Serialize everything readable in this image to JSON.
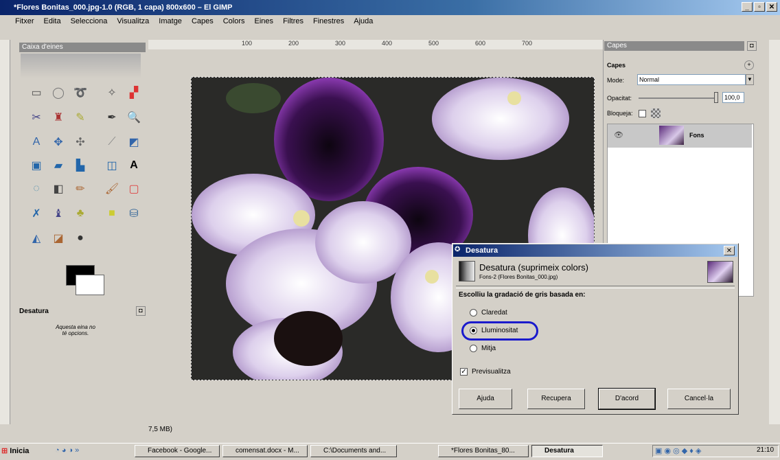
{
  "window": {
    "title": "*Flores Bonitas_000.jpg-1.0 (RGB, 1 capa) 800x600 – El GIMP",
    "controls": [
      "_",
      "▫",
      "✕"
    ]
  },
  "menu": [
    "Fitxer",
    "Edita",
    "Selecciona",
    "Visualitza",
    "Imatge",
    "Capes",
    "Colors",
    "Eines",
    "Filtres",
    "Finestres",
    "Ajuda"
  ],
  "toolbox": {
    "title": "Caixa d'eines",
    "panel_title": "Desatura",
    "panel_text": "Aquesta eina no té opcions."
  },
  "ruler": {
    "marks": [
      "100",
      "200",
      "300",
      "400",
      "500",
      "600",
      "700"
    ]
  },
  "status": {
    "text": "7,5 MB)"
  },
  "layers": {
    "title": "Capes",
    "section": "Capes",
    "mode_label": "Mode:",
    "mode_value": "Normal",
    "opacity_label": "Opacitat:",
    "opacity_value": "100,0",
    "lock_label": "Bloqueja:",
    "layer_name": "Fons"
  },
  "dialog": {
    "title": "Desatura",
    "heading": "Desatura (suprimeix colors)",
    "subtitle": "Fons-2 (Flores Bonitas_000.jpg)",
    "question": "Escolliu la gradació de gris basada en:",
    "options": [
      {
        "label": "Claredat",
        "selected": false
      },
      {
        "label": "Lluminositat",
        "selected": true
      },
      {
        "label": "Mitja",
        "selected": false
      }
    ],
    "preview_label": "Previsualitza",
    "preview_checked": true,
    "buttons": {
      "help": "Ajuda",
      "reset": "Recupera",
      "ok": "D'acord",
      "cancel": "Cancel·la"
    }
  },
  "taskbar": {
    "start": "Inicia",
    "tasks": [
      {
        "label": "Facebook - Google...",
        "active": false
      },
      {
        "label": "comensat.docx - M...",
        "active": false
      },
      {
        "label": "C:\\Documents and...",
        "active": false
      },
      {
        "label": "*Flores Bonitas_80...",
        "active": false
      },
      {
        "label": "Desatura",
        "active": true
      }
    ],
    "clock": "21:10"
  }
}
